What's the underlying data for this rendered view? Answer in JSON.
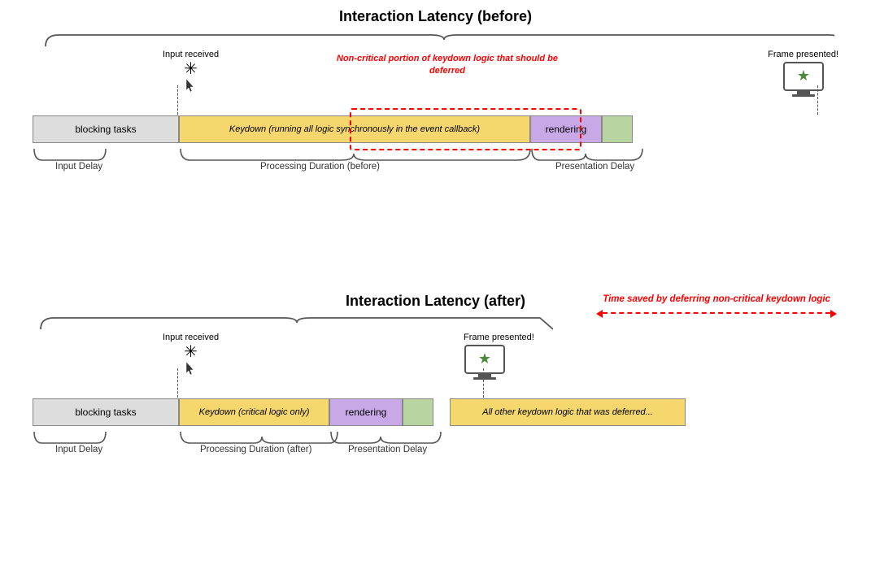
{
  "section1": {
    "title": "Interaction Latency (before)",
    "input_label": "Input received",
    "frame_label": "Frame presented!",
    "bars": {
      "blocking": "blocking tasks",
      "keydown": "Keydown (running all logic synchronously in the event callback)",
      "rendering": "rendering"
    },
    "brace_labels": {
      "input_delay": "Input Delay",
      "processing_duration": "Processing Duration (before)",
      "presentation_delay": "Presentation Delay"
    },
    "red_note": "Non-critical portion of keydown\nlogic that should be deferred"
  },
  "section2": {
    "title": "Interaction Latency (after)",
    "input_label": "Input received",
    "frame_label": "Frame presented!",
    "bars": {
      "blocking": "blocking tasks",
      "keydown": "Keydown (critical logic only)",
      "rendering": "rendering",
      "deferred": "All other keydown logic that was deferred..."
    },
    "brace_labels": {
      "input_delay": "Input Delay",
      "processing_duration": "Processing Duration (after)",
      "presentation_delay": "Presentation Delay"
    },
    "time_saved_label": "Time saved by deferring\nnon-critical keydown logic"
  }
}
